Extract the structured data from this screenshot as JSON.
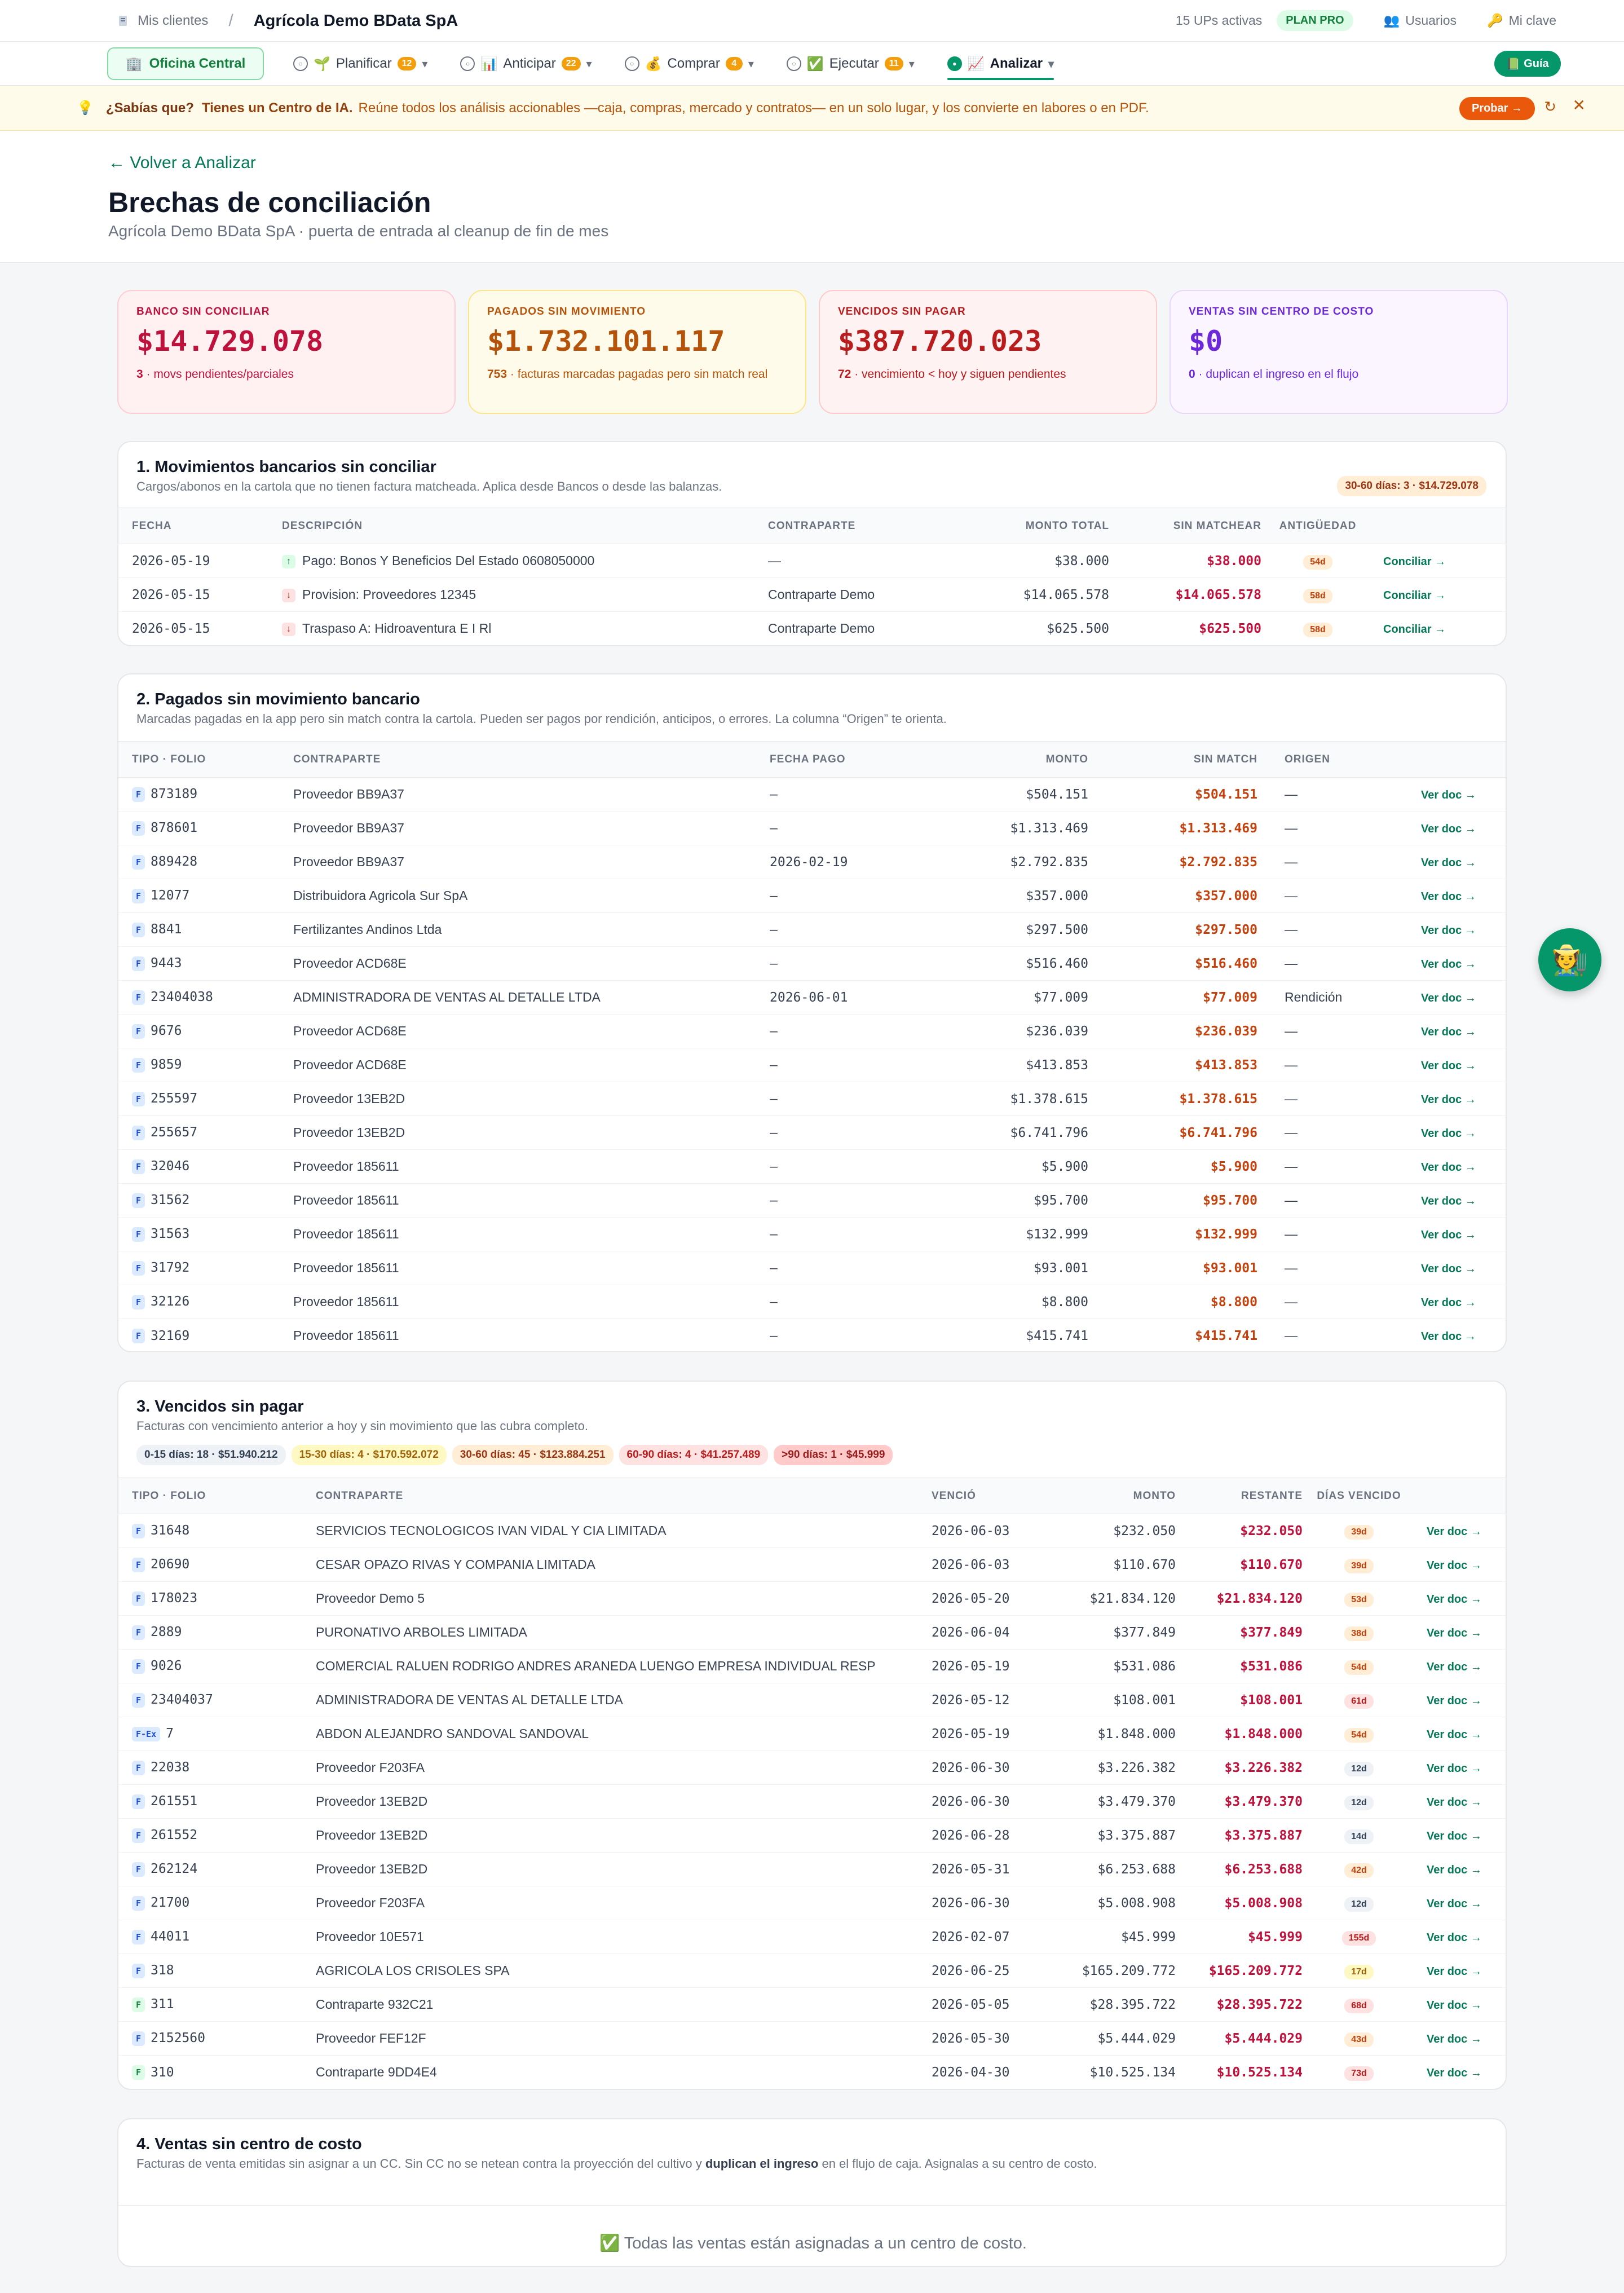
{
  "topbar": {
    "crumb": "Mis clientes",
    "company": "Agrícola Demo BData SpA",
    "ups": "15 UPs activas",
    "plan": "PLAN PRO",
    "users": "Usuarios",
    "key": "Mi clave"
  },
  "nav": {
    "oficina": "Oficina Central",
    "items": [
      {
        "label": "Planificar",
        "badge": "12"
      },
      {
        "label": "Anticipar",
        "badge": "22"
      },
      {
        "label": "Comprar",
        "badge": "4"
      },
      {
        "label": "Ejecutar",
        "badge": "11"
      },
      {
        "label": "Analizar",
        "badge": ""
      }
    ],
    "guia": "Guía"
  },
  "banner": {
    "q": "¿Sabías que?",
    "title": "Tienes un Centro de IA.",
    "desc": "Reúne todos los análisis accionables —caja, compras, mercado y contratos— en un solo lugar, y los convierte en labores o en PDF.",
    "cta": "Probar →"
  },
  "header": {
    "back": "← Volver a Analizar",
    "title": "Brechas de conciliación",
    "subtitle": "Agrícola Demo BData SpA · puerta de entrada al cleanup de fin de mes"
  },
  "kpis": [
    {
      "label": "BANCO SIN CONCILIAR",
      "value": "$14.729.078",
      "count": "3",
      "desc": " · movs pendientes/parciales"
    },
    {
      "label": "PAGADOS SIN MOVIMIENTO",
      "value": "$1.732.101.117",
      "count": "753",
      "desc": " · facturas marcadas pagadas pero sin match real"
    },
    {
      "label": "VENCIDOS SIN PAGAR",
      "value": "$387.720.023",
      "count": "72",
      "desc": " · vencimiento < hoy y siguen pendientes"
    },
    {
      "label": "VENTAS SIN CENTRO DE COSTO",
      "value": "$0",
      "count": "0",
      "desc": " · duplican el ingreso en el flujo"
    }
  ],
  "sec1": {
    "title": "1. Movimientos bancarios sin conciliar",
    "subtitle": "Cargos/abonos en la cartola que no tienen factura matcheada. Aplica desde Bancos o desde las balanzas.",
    "chip": "30-60 días: 3 · $14.729.078",
    "headers": [
      "FECHA",
      "DESCRIPCIÓN",
      "CONTRAPARTE",
      "MONTO TOTAL",
      "SIN MATCHEAR",
      "ANTIGÜEDAD"
    ],
    "action": "Conciliar →",
    "rows": [
      {
        "date": "2026-05-19",
        "dir": "up",
        "desc": "Pago: Bonos Y Beneficios Del Estado 0608050000",
        "cp": "—",
        "total": "$38.000",
        "sin": "$38.000",
        "age": "54d"
      },
      {
        "date": "2026-05-15",
        "dir": "dn",
        "desc": "Provision: Proveedores 12345",
        "cp": "Contraparte Demo",
        "total": "$14.065.578",
        "sin": "$14.065.578",
        "age": "58d"
      },
      {
        "date": "2026-05-15",
        "dir": "dn",
        "desc": "Traspaso A: Hidroaventura E I Rl",
        "cp": "Contraparte Demo",
        "total": "$625.500",
        "sin": "$625.500",
        "age": "58d"
      }
    ]
  },
  "sec2": {
    "title": "2. Pagados sin movimiento bancario",
    "subtitle": "Marcadas pagadas en la app pero sin match contra la cartola. Pueden ser pagos por rendición, anticipos, o errores. La columna “Origen” te orienta.",
    "headers": [
      "TIPO · FOLIO",
      "CONTRAPARTE",
      "FECHA PAGO",
      "MONTO",
      "SIN MATCH",
      "ORIGEN"
    ],
    "action": "Ver doc →",
    "rows": [
      {
        "tag": "F",
        "folio": "873189",
        "cp": "Proveedor BB9A37",
        "fecha": "—",
        "monto": "$504.151",
        "sin": "$504.151",
        "origen": "—"
      },
      {
        "tag": "F",
        "folio": "878601",
        "cp": "Proveedor BB9A37",
        "fecha": "—",
        "monto": "$1.313.469",
        "sin": "$1.313.469",
        "origen": "—"
      },
      {
        "tag": "F",
        "folio": "889428",
        "cp": "Proveedor BB9A37",
        "fecha": "2026-02-19",
        "monto": "$2.792.835",
        "sin": "$2.792.835",
        "origen": "—"
      },
      {
        "tag": "F",
        "folio": "12077",
        "cp": "Distribuidora Agricola Sur SpA",
        "fecha": "—",
        "monto": "$357.000",
        "sin": "$357.000",
        "origen": "—"
      },
      {
        "tag": "F",
        "folio": "8841",
        "cp": "Fertilizantes Andinos Ltda",
        "fecha": "—",
        "monto": "$297.500",
        "sin": "$297.500",
        "origen": "—"
      },
      {
        "tag": "F",
        "folio": "9443",
        "cp": "Proveedor ACD68E",
        "fecha": "—",
        "monto": "$516.460",
        "sin": "$516.460",
        "origen": "—"
      },
      {
        "tag": "F",
        "folio": "23404038",
        "cp": "ADMINISTRADORA DE VENTAS AL DETALLE LTDA",
        "fecha": "2026-06-01",
        "monto": "$77.009",
        "sin": "$77.009",
        "origen": "Rendición"
      },
      {
        "tag": "F",
        "folio": "9676",
        "cp": "Proveedor ACD68E",
        "fecha": "—",
        "monto": "$236.039",
        "sin": "$236.039",
        "origen": "—"
      },
      {
        "tag": "F",
        "folio": "9859",
        "cp": "Proveedor ACD68E",
        "fecha": "—",
        "monto": "$413.853",
        "sin": "$413.853",
        "origen": "—"
      },
      {
        "tag": "F",
        "folio": "255597",
        "cp": "Proveedor 13EB2D",
        "fecha": "—",
        "monto": "$1.378.615",
        "sin": "$1.378.615",
        "origen": "—"
      },
      {
        "tag": "F",
        "folio": "255657",
        "cp": "Proveedor 13EB2D",
        "fecha": "—",
        "monto": "$6.741.796",
        "sin": "$6.741.796",
        "origen": "—"
      },
      {
        "tag": "F",
        "folio": "32046",
        "cp": "Proveedor 185611",
        "fecha": "—",
        "monto": "$5.900",
        "sin": "$5.900",
        "origen": "—"
      },
      {
        "tag": "F",
        "folio": "31562",
        "cp": "Proveedor 185611",
        "fecha": "—",
        "monto": "$95.700",
        "sin": "$95.700",
        "origen": "—"
      },
      {
        "tag": "F",
        "folio": "31563",
        "cp": "Proveedor 185611",
        "fecha": "—",
        "monto": "$132.999",
        "sin": "$132.999",
        "origen": "—"
      },
      {
        "tag": "F",
        "folio": "31792",
        "cp": "Proveedor 185611",
        "fecha": "—",
        "monto": "$93.001",
        "sin": "$93.001",
        "origen": "—"
      },
      {
        "tag": "F",
        "folio": "32126",
        "cp": "Proveedor 185611",
        "fecha": "—",
        "monto": "$8.800",
        "sin": "$8.800",
        "origen": "—"
      },
      {
        "tag": "F",
        "folio": "32169",
        "cp": "Proveedor 185611",
        "fecha": "—",
        "monto": "$415.741",
        "sin": "$415.741",
        "origen": "—"
      }
    ]
  },
  "sec3": {
    "title": "3. Vencidos sin pagar",
    "subtitle": "Facturas con vencimiento anterior a hoy y sin movimiento que las cubra completo.",
    "chips": [
      "0-15 días: 18 · $51.940.212",
      "15-30 días: 4 · $170.592.072",
      "30-60 días: 45 · $123.884.251",
      "60-90 días: 4 · $41.257.489",
      ">90 días: 1 · $45.999"
    ],
    "headers": [
      "TIPO · FOLIO",
      "CONTRAPARTE",
      "VENCIÓ",
      "MONTO",
      "RESTANTE",
      "DÍAS VENCIDO"
    ],
    "action": "Ver doc →",
    "rows": [
      {
        "tag": "F",
        "folio": "31648",
        "cp": "SERVICIOS TECNOLOGICOS IVAN VIDAL Y CIA LIMITADA",
        "venc": "2026-06-03",
        "monto": "$232.050",
        "rest": "$232.050",
        "dias": "39d",
        "lv": "o"
      },
      {
        "tag": "F",
        "folio": "20690",
        "cp": "CESAR OPAZO RIVAS Y COMPANIA LIMITADA",
        "venc": "2026-06-03",
        "monto": "$110.670",
        "rest": "$110.670",
        "dias": "39d",
        "lv": "o"
      },
      {
        "tag": "F",
        "folio": "178023",
        "cp": "Proveedor Demo 5",
        "venc": "2026-05-20",
        "monto": "$21.834.120",
        "rest": "$21.834.120",
        "dias": "53d",
        "lv": "o"
      },
      {
        "tag": "F",
        "folio": "2889",
        "cp": "PURONATIVO ARBOLES LIMITADA",
        "venc": "2026-06-04",
        "monto": "$377.849",
        "rest": "$377.849",
        "dias": "38d",
        "lv": "o"
      },
      {
        "tag": "F",
        "folio": "9026",
        "cp": "COMERCIAL RALUEN RODRIGO ANDRES ARANEDA LUENGO EMPRESA INDIVIDUAL RESP",
        "venc": "2026-05-19",
        "monto": "$531.086",
        "rest": "$531.086",
        "dias": "54d",
        "lv": "o"
      },
      {
        "tag": "F",
        "folio": "23404037",
        "cp": "ADMINISTRADORA DE VENTAS AL DETALLE LTDA",
        "venc": "2026-05-12",
        "monto": "$108.001",
        "rest": "$108.001",
        "dias": "61d",
        "lv": "r"
      },
      {
        "tag": "F-Ex",
        "folio": "7",
        "cp": "ABDON ALEJANDRO SANDOVAL SANDOVAL",
        "venc": "2026-05-19",
        "monto": "$1.848.000",
        "rest": "$1.848.000",
        "dias": "54d",
        "lv": "o"
      },
      {
        "tag": "F",
        "folio": "22038",
        "cp": "Proveedor F203FA",
        "venc": "2026-06-30",
        "monto": "$3.226.382",
        "rest": "$3.226.382",
        "dias": "12d",
        "lv": "s"
      },
      {
        "tag": "F",
        "folio": "261551",
        "cp": "Proveedor 13EB2D",
        "venc": "2026-06-30",
        "monto": "$3.479.370",
        "rest": "$3.479.370",
        "dias": "12d",
        "lv": "s"
      },
      {
        "tag": "F",
        "folio": "261552",
        "cp": "Proveedor 13EB2D",
        "venc": "2026-06-28",
        "monto": "$3.375.887",
        "rest": "$3.375.887",
        "dias": "14d",
        "lv": "s"
      },
      {
        "tag": "F",
        "folio": "262124",
        "cp": "Proveedor 13EB2D",
        "venc": "2026-05-31",
        "monto": "$6.253.688",
        "rest": "$6.253.688",
        "dias": "42d",
        "lv": "o"
      },
      {
        "tag": "F",
        "folio": "21700",
        "cp": "Proveedor F203FA",
        "venc": "2026-06-30",
        "monto": "$5.008.908",
        "rest": "$5.008.908",
        "dias": "12d",
        "lv": "s"
      },
      {
        "tag": "F",
        "folio": "44011",
        "cp": "Proveedor 10E571",
        "venc": "2026-02-07",
        "monto": "$45.999",
        "rest": "$45.999",
        "dias": "155d",
        "lv": "r"
      },
      {
        "tag": "F",
        "folio": "318",
        "cp": "AGRICOLA LOS CRISOLES SPA",
        "venc": "2026-06-25",
        "monto": "$165.209.772",
        "rest": "$165.209.772",
        "dias": "17d",
        "lv": "y"
      },
      {
        "tag": "F",
        "folio": "311",
        "cp": "Contraparte 932C21",
        "venc": "2026-05-05",
        "monto": "$28.395.722",
        "rest": "$28.395.722",
        "dias": "68d",
        "lv": "r",
        "g": true
      },
      {
        "tag": "F",
        "folio": "2152560",
        "cp": "Proveedor FEF12F",
        "venc": "2026-05-30",
        "monto": "$5.444.029",
        "rest": "$5.444.029",
        "dias": "43d",
        "lv": "o"
      },
      {
        "tag": "F",
        "folio": "310",
        "cp": "Contraparte 9DD4E4",
        "venc": "2026-04-30",
        "monto": "$10.525.134",
        "rest": "$10.525.134",
        "dias": "73d",
        "lv": "r",
        "g": true
      }
    ]
  },
  "sec4": {
    "title": "4. Ventas sin centro de costo",
    "sub_a": "Facturas de venta emitidas sin asignar a un CC. Sin CC no se netean contra la proyección del cultivo y ",
    "sub_b": "duplican el ingreso",
    "sub_c": " en el flujo de caja. Asignalas a su centro de costo.",
    "empty": "Todas las ventas están asignadas a un centro de costo."
  },
  "colors": {
    "accent": "#059669",
    "danger": "#be123c",
    "warning": "#c2410c",
    "purple": "#6d28d9"
  }
}
